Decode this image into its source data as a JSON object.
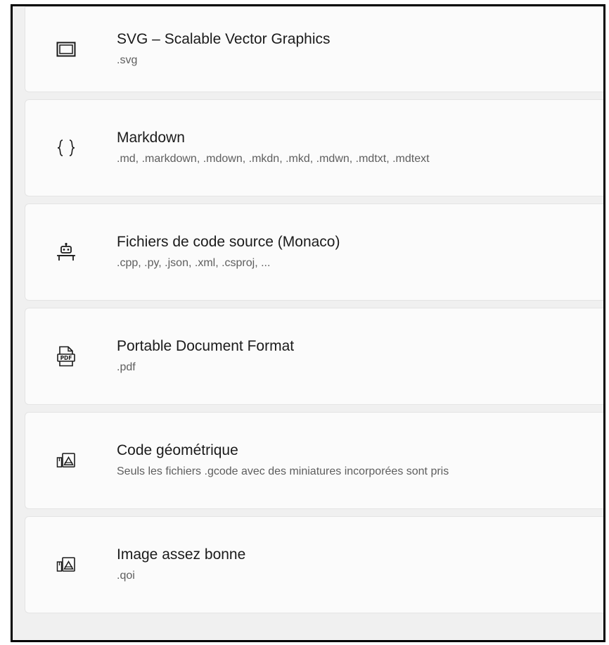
{
  "file_types": [
    {
      "icon": "window-icon",
      "title": "SVG – Scalable Vector Graphics",
      "subtitle": ".svg"
    },
    {
      "icon": "braces-icon",
      "title": "Markdown",
      "subtitle": ".md, .markdown, .mdown, .mkdn, .mkd, .mdwn, .mdtxt, .mdtext"
    },
    {
      "icon": "robot-icon",
      "title": "Fichiers de code source (Monaco)",
      "subtitle": ".cpp, .py, .json, .xml, .csproj, ..."
    },
    {
      "icon": "pdf-document-icon",
      "title": "Portable Document Format",
      "subtitle": ".pdf"
    },
    {
      "icon": "image-file-icon",
      "title": "Code géométrique",
      "subtitle": "Seuls les fichiers .gcode avec des miniatures incorporées sont pris"
    },
    {
      "icon": "image-file-icon",
      "title": "Image assez bonne",
      "subtitle": ".qoi"
    }
  ]
}
